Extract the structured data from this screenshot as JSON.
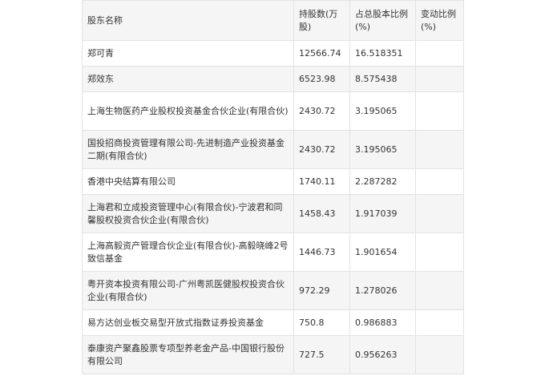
{
  "table": {
    "headers": [
      "股东名称",
      "持股数(万股)",
      "占总股本比例(%)",
      "变动比例(%)"
    ],
    "rows": [
      {
        "name": "郑可青",
        "shares": "12566.74",
        "ratio": "16.518351",
        "change": ""
      },
      {
        "name": "郑效东",
        "shares": "6523.98",
        "ratio": "8.575438",
        "change": ""
      },
      {
        "name": "上海生物医药产业股权投资基金合伙企业(有限合伙)",
        "shares": "2430.72",
        "ratio": "3.195065",
        "change": ""
      },
      {
        "name": "国投招商投资管理有限公司-先进制造产业投资基金二期(有限合伙)",
        "shares": "2430.72",
        "ratio": "3.195065",
        "change": ""
      },
      {
        "name": "香港中央结算有限公司",
        "shares": "1740.11",
        "ratio": "2.287282",
        "change": ""
      },
      {
        "name": "上海君和立成投资管理中心(有限合伙)-宁波君和同馨股权投资合伙企业(有限合伙)",
        "shares": "1458.43",
        "ratio": "1.917039",
        "change": ""
      },
      {
        "name": "上海高毅资产管理合伙企业(有限合伙)-高毅晓峰2号致信基金",
        "shares": "1446.73",
        "ratio": "1.901654",
        "change": ""
      },
      {
        "name": "粤开资本投资有限公司-广州粤凯医健股权投资合伙企业(有限合伙)",
        "shares": "972.29",
        "ratio": "1.278026",
        "change": ""
      },
      {
        "name": "易方达创业板交易型开放式指数证券投资基金",
        "shares": "750.8",
        "ratio": "0.986883",
        "change": ""
      },
      {
        "name": "泰康资产聚鑫股票专项型养老金产品-中国银行股份有限公司",
        "shares": "727.5",
        "ratio": "0.956263",
        "change": ""
      }
    ]
  }
}
